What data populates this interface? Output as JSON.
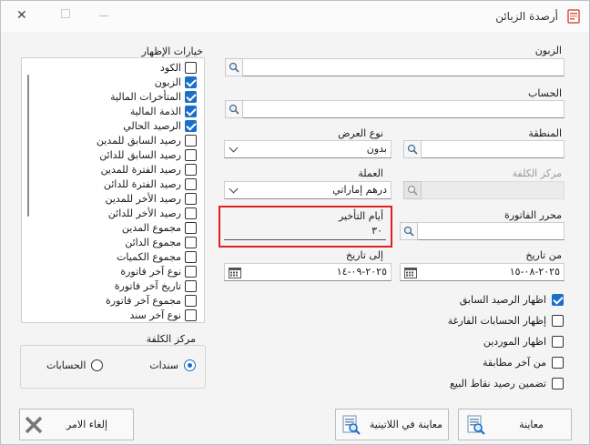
{
  "window": {
    "title": "أرصدة الزبائن",
    "controls": {
      "close": "✕",
      "maximize": "☐",
      "minimize": "—"
    }
  },
  "form": {
    "customer": {
      "label": "الزبون",
      "value": ""
    },
    "account": {
      "label": "الحساب",
      "value": ""
    },
    "region": {
      "label": "المنطقة",
      "value": ""
    },
    "display_type": {
      "label": "نوع العرض",
      "value": "بدون"
    },
    "cost_center": {
      "label": "مركز الكلفة",
      "value": ""
    },
    "currency": {
      "label": "العملة",
      "value": "درهم إماراتي"
    },
    "invoice_editor": {
      "label": "محرر الفاتورة",
      "value": ""
    },
    "delay_days": {
      "label": "أيام التأخير",
      "value": "٣٠"
    },
    "from_date": {
      "label": "من تاريخ",
      "value": "٢٠٢٥-٠٨-١٥"
    },
    "to_date": {
      "label": "إلى تاريخ",
      "value": "٢٠٢٥-٠٩-١٤"
    }
  },
  "options": [
    {
      "label": "اظهار الرصيد السابق",
      "checked": true
    },
    {
      "label": "إظهار الحسابات الفارغة",
      "checked": false
    },
    {
      "label": "اظهار الموردين",
      "checked": false
    },
    {
      "label": "من آخر مطابقة",
      "checked": false
    },
    {
      "label": "تضمين رصيد نقاط البيع",
      "checked": false
    }
  ],
  "display_options": {
    "title": "خيارات الإظهار",
    "items": [
      {
        "label": "الكود",
        "checked": false
      },
      {
        "label": "الزبون",
        "checked": true
      },
      {
        "label": "المتأخرات المالية",
        "checked": true
      },
      {
        "label": "الذمة المالية",
        "checked": true
      },
      {
        "label": "الرصيد الحالي",
        "checked": true
      },
      {
        "label": "رصيد السابق للمدين",
        "checked": false
      },
      {
        "label": "رصيد السابق للدائن",
        "checked": false
      },
      {
        "label": "رصيد الفترة للمدين",
        "checked": false
      },
      {
        "label": "رصيد الفترة للدائن",
        "checked": false
      },
      {
        "label": "رصيد الأخر للمدين",
        "checked": false
      },
      {
        "label": "رصيد الأخر للدائن",
        "checked": false
      },
      {
        "label": "مجموع المدين",
        "checked": false
      },
      {
        "label": "مجموع الدائن",
        "checked": false
      },
      {
        "label": "مجموع الكميات",
        "checked": false
      },
      {
        "label": "نوع آخر فاتورة",
        "checked": false
      },
      {
        "label": "تاريخ آخر فاتورة",
        "checked": false
      },
      {
        "label": "مجموع آخر فاتورة",
        "checked": false
      },
      {
        "label": "نوع آخر سند",
        "checked": false
      }
    ]
  },
  "cost_center_group": {
    "title": "مركز الكلفة",
    "options": [
      {
        "label": "سندات",
        "selected": true
      },
      {
        "label": "الحسابات",
        "selected": false
      }
    ]
  },
  "buttons": {
    "preview": "معاينة",
    "preview_latin": "معاينة في اللاتينية",
    "cancel": "إلغاء الامر"
  },
  "colors": {
    "accent": "#1a6fc8",
    "highlight": "#e02020",
    "window_bg": "#f4f4f4"
  },
  "icons": {
    "search": "magnifier-icon",
    "calendar": "calendar-icon",
    "dropdown": "chevron-down-icon",
    "preview": "report-preview-icon",
    "cancel": "close-x-icon"
  }
}
